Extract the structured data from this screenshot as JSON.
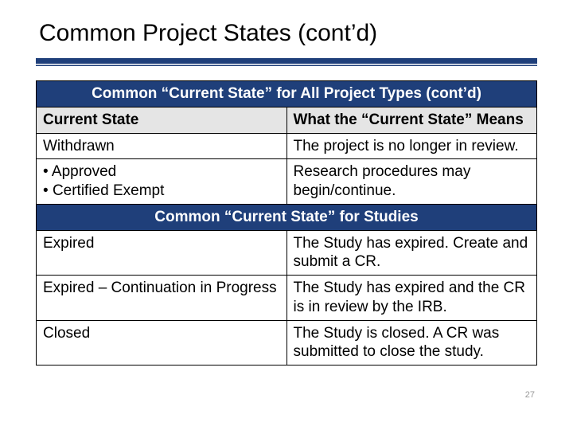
{
  "title": "Common Project States (cont’d)",
  "page_number": "27",
  "band1": "Common “Current State” for All Project Types (cont’d)",
  "header": {
    "c1": "Current State",
    "c2": "What the “Current State” Means"
  },
  "rows1": [
    {
      "c1": "Withdrawn",
      "c2": "The project is no longer in review."
    },
    {
      "bullets": [
        "Approved",
        "Certified Exempt"
      ],
      "c2": "Research procedures may begin/continue."
    }
  ],
  "band2": "Common “Current State” for Studies",
  "rows2": [
    {
      "c1": "Expired",
      "c2": "The Study has expired. Create and submit a CR."
    },
    {
      "c1": "Expired – Continuation in Progress",
      "c2": "The Study has expired and the CR is in review by the IRB."
    },
    {
      "c1": "Closed",
      "c2": "The Study is closed. A CR was submitted to close the study."
    }
  ],
  "chart_data": {
    "type": "table",
    "title": "Common Project States (cont’d)",
    "sections": [
      {
        "heading": "Common “Current State” for All Project Types (cont’d)",
        "columns": [
          "Current State",
          "What the “Current State” Means"
        ],
        "rows": [
          [
            "Withdrawn",
            "The project is no longer in review."
          ],
          [
            "Approved / Certified Exempt",
            "Research procedures may begin/continue."
          ]
        ]
      },
      {
        "heading": "Common “Current State” for Studies",
        "rows": [
          [
            "Expired",
            "The Study has expired. Create and submit a CR."
          ],
          [
            "Expired – Continuation in Progress",
            "The Study has expired and the CR is in review by the IRB."
          ],
          [
            "Closed",
            "The Study is closed. A CR was submitted to close the study."
          ]
        ]
      }
    ]
  }
}
